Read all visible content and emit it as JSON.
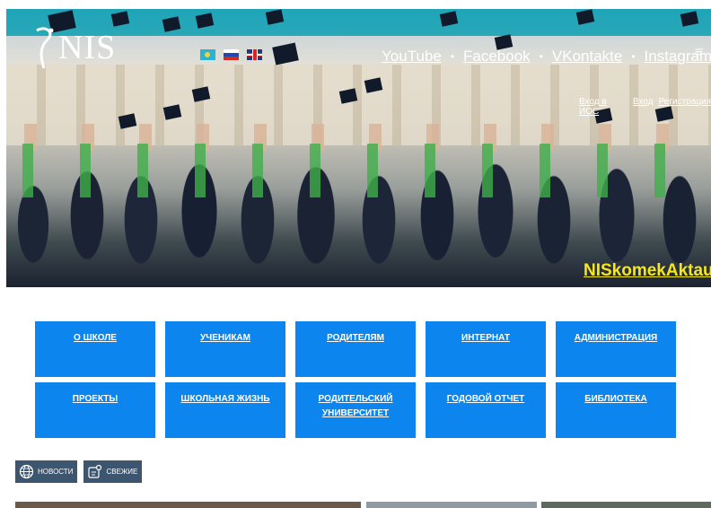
{
  "brand": {
    "name": "NIS"
  },
  "languages": [
    "kz",
    "ru",
    "en"
  ],
  "social": {
    "links": [
      "YouTube",
      "Facebook",
      "VKontakte",
      "Instagram"
    ],
    "separator": "•"
  },
  "auth": {
    "ios_login": "Вход в ИОС",
    "login": "Вход",
    "register": "Регистрация"
  },
  "hero": {
    "hashtag": "NISkomekAktau"
  },
  "nav": {
    "tiles": [
      {
        "label": "О ШКОЛЕ"
      },
      {
        "label": "УЧЕНИКАМ"
      },
      {
        "label": "РОДИТЕЛЯМ"
      },
      {
        "label": "ИНТЕРНАТ"
      },
      {
        "label": "АДМИНИСТРАЦИЯ"
      },
      {
        "label": "ПРОЕКТЫ"
      },
      {
        "label": "ШКОЛЬНАЯ ЖИЗНЬ"
      },
      {
        "label": "РОДИТЕЛЬСКИЙ УНИВЕРСИТЕТ"
      },
      {
        "label": "ГОДОВОЙ ОТЧЕТ"
      },
      {
        "label": "БИБЛИОТЕКА"
      }
    ]
  },
  "chips": {
    "news": "НОВОСТИ",
    "fresh": "СВЕЖИЕ",
    "news_icon": "globe-icon",
    "fresh_icon": "new-icon"
  },
  "colors": {
    "tile": "#0c86ee",
    "chip": "#3d5670",
    "hashtag": "#f6e71b",
    "topbar": "#1fa4b8"
  }
}
